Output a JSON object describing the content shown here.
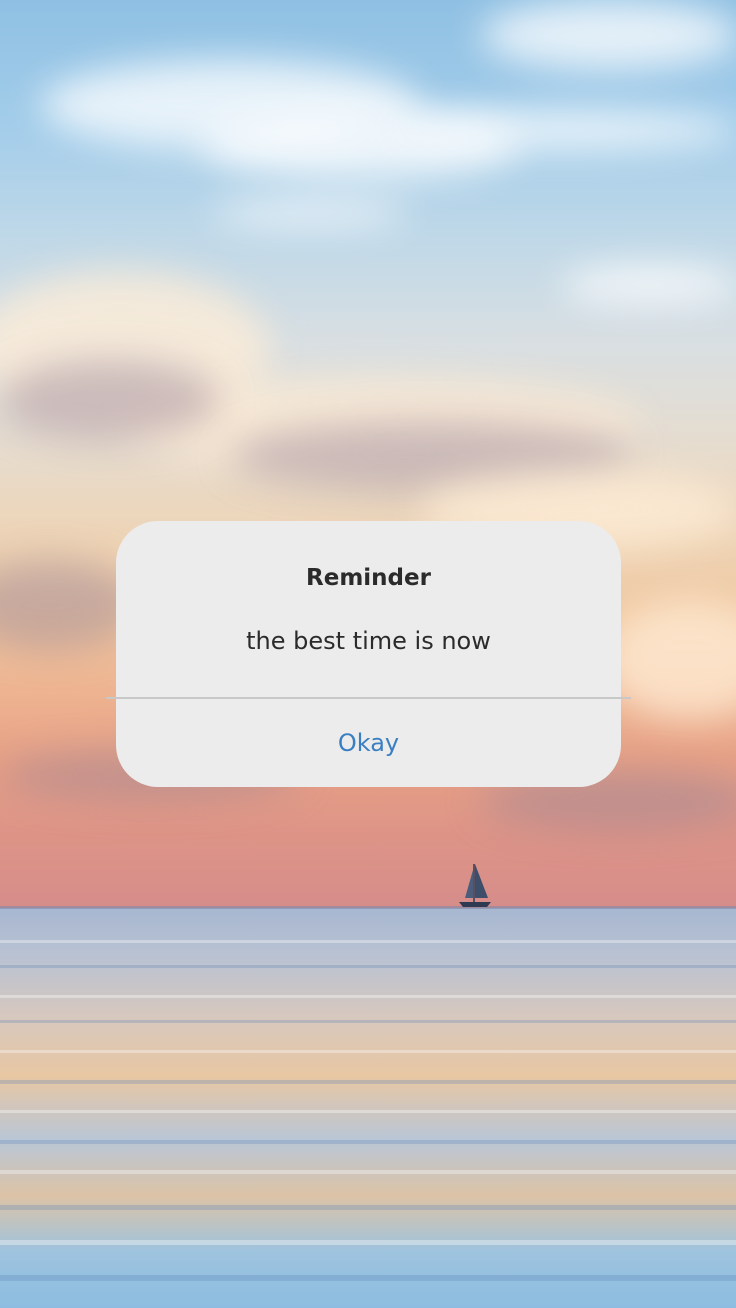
{
  "dialog": {
    "title": "Reminder",
    "message": "the best time is now",
    "button_label": "Okay"
  },
  "colors": {
    "dialog_background": "#ececec",
    "button_text": "#3a7fc2",
    "title_text": "#2b2b2b"
  },
  "icons": {
    "boat": "sailboat-icon"
  }
}
